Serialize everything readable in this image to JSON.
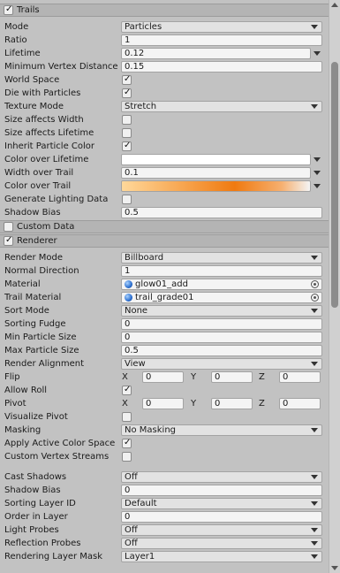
{
  "trails": {
    "title": "Trails",
    "enabled": true,
    "mode": {
      "label": "Mode",
      "value": "Particles"
    },
    "ratio": {
      "label": "Ratio",
      "value": "1"
    },
    "lifetime": {
      "label": "Lifetime",
      "value": "0.12"
    },
    "min_vertex_distance": {
      "label": "Minimum Vertex Distance",
      "value": "0.15"
    },
    "world_space": {
      "label": "World Space",
      "checked": true
    },
    "die_with_particles": {
      "label": "Die with Particles",
      "checked": true
    },
    "texture_mode": {
      "label": "Texture Mode",
      "value": "Stretch"
    },
    "size_affects_width": {
      "label": "Size affects Width",
      "checked": false
    },
    "size_affects_lifetime": {
      "label": "Size affects Lifetime",
      "checked": false
    },
    "inherit_particle_color": {
      "label": "Inherit Particle Color",
      "checked": true
    },
    "color_over_lifetime": {
      "label": "Color over Lifetime",
      "color": "#ffffff"
    },
    "width_over_trail": {
      "label": "Width over Trail",
      "value": "0.1"
    },
    "color_over_trail": {
      "label": "Color over Trail",
      "gradient_start": "#ffd89a",
      "gradient_end": "#f07a10"
    },
    "generate_lighting_data": {
      "label": "Generate Lighting Data",
      "checked": false
    },
    "shadow_bias": {
      "label": "Shadow Bias",
      "value": "0.5"
    }
  },
  "custom_data": {
    "title": "Custom Data",
    "enabled": false
  },
  "renderer": {
    "title": "Renderer",
    "enabled": true,
    "render_mode": {
      "label": "Render Mode",
      "value": "Billboard"
    },
    "normal_direction": {
      "label": "Normal Direction",
      "value": "1"
    },
    "material": {
      "label": "Material",
      "value": "glow01_add",
      "icon": "material-sphere-icon"
    },
    "trail_material": {
      "label": "Trail Material",
      "value": "trail_grade01",
      "icon": "material-sphere-icon"
    },
    "sort_mode": {
      "label": "Sort Mode",
      "value": "None"
    },
    "sorting_fudge": {
      "label": "Sorting Fudge",
      "value": "0"
    },
    "min_particle_size": {
      "label": "Min Particle Size",
      "value": "0"
    },
    "max_particle_size": {
      "label": "Max Particle Size",
      "value": "0.5"
    },
    "render_alignment": {
      "label": "Render Alignment",
      "value": "View"
    },
    "flip": {
      "label": "Flip",
      "x_label": "X",
      "x": "0",
      "y_label": "Y",
      "y": "0",
      "z_label": "Z",
      "z": "0"
    },
    "allow_roll": {
      "label": "Allow Roll",
      "checked": true
    },
    "pivot": {
      "label": "Pivot",
      "x_label": "X",
      "x": "0",
      "y_label": "Y",
      "y": "0",
      "z_label": "Z",
      "z": "0"
    },
    "visualize_pivot": {
      "label": "Visualize Pivot",
      "checked": false
    },
    "masking": {
      "label": "Masking",
      "value": "No Masking"
    },
    "apply_active_color_space": {
      "label": "Apply Active Color Space",
      "checked": true
    },
    "custom_vertex_streams": {
      "label": "Custom Vertex Streams",
      "checked": false
    },
    "cast_shadows": {
      "label": "Cast Shadows",
      "value": "Off"
    },
    "shadow_bias": {
      "label": "Shadow Bias",
      "value": "0"
    },
    "sorting_layer_id": {
      "label": "Sorting Layer ID",
      "value": "Default"
    },
    "order_in_layer": {
      "label": "Order in Layer",
      "value": "0"
    },
    "light_probes": {
      "label": "Light Probes",
      "value": "Off"
    },
    "reflection_probes": {
      "label": "Reflection Probes",
      "value": "Off"
    },
    "rendering_layer_mask": {
      "label": "Rendering Layer Mask",
      "value": "Layer1"
    }
  },
  "check_glyph": "✓"
}
